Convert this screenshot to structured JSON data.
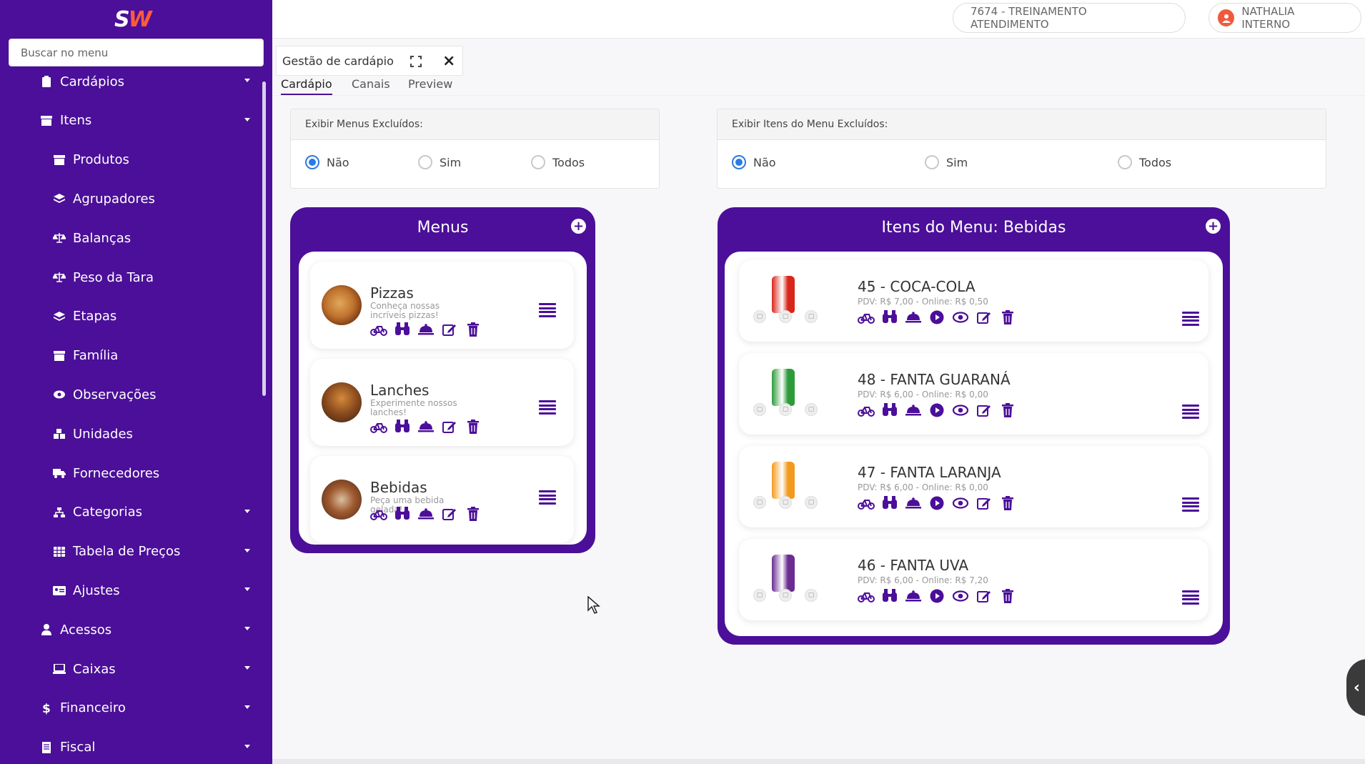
{
  "app": {
    "logo_text": "SW",
    "search_placeholder": "Buscar no menu"
  },
  "colors": {
    "brand": "#4b0f99",
    "accent": "#ff5a3c",
    "radio_selected": "#2a7be4"
  },
  "sidebar": {
    "items": [
      {
        "label": "Cardápios",
        "icon": "clipboard-icon",
        "caret": true
      },
      {
        "label": "Itens",
        "icon": "box-icon",
        "caret": true
      },
      {
        "label": "Produtos",
        "icon": "box-icon",
        "caret": false
      },
      {
        "label": "Agrupadores",
        "icon": "layers-icon",
        "caret": false
      },
      {
        "label": "Balanças",
        "icon": "scale-icon",
        "caret": false
      },
      {
        "label": "Peso da Tara",
        "icon": "scale-icon",
        "caret": false
      },
      {
        "label": "Etapas",
        "icon": "layers-icon",
        "caret": false
      },
      {
        "label": "Família",
        "icon": "box-icon",
        "caret": false
      },
      {
        "label": "Observações",
        "icon": "eye-icon",
        "caret": false
      },
      {
        "label": "Unidades",
        "icon": "cubes-icon",
        "caret": false
      },
      {
        "label": "Fornecedores",
        "icon": "truck-icon",
        "caret": false
      },
      {
        "label": "Categorias",
        "icon": "sitemap-icon",
        "caret": true
      },
      {
        "label": "Tabela de Preços",
        "icon": "table-icon",
        "caret": true
      },
      {
        "label": "Ajustes",
        "icon": "id-card-icon",
        "caret": true
      },
      {
        "label": "Acessos",
        "icon": "user-icon",
        "caret": true
      },
      {
        "label": "Caixas",
        "icon": "laptop-icon",
        "caret": true
      },
      {
        "label": "Financeiro",
        "icon": "dollar-icon",
        "caret": true
      },
      {
        "label": "Fiscal",
        "icon": "receipt-icon",
        "caret": true
      }
    ]
  },
  "topbar": {
    "store": "7674 - TREINAMENTO ATENDIMENTO",
    "user": "NATHALIA INTERNO"
  },
  "window": {
    "title": "Gestão de cardápio",
    "tabs": [
      "Cardápio",
      "Canais",
      "Preview"
    ]
  },
  "filters": {
    "menus": {
      "label": "Exibir Menus Excluídos:",
      "options": [
        "Não",
        "Sim",
        "Todos"
      ],
      "selected": "Não"
    },
    "items": {
      "label": "Exibir Itens do Menu Excluídos:",
      "options": [
        "Não",
        "Sim",
        "Todos"
      ],
      "selected": "Não"
    }
  },
  "menus_card": {
    "title": "Menus",
    "rows": [
      {
        "name": "Pizzas",
        "description": "Conheça nossas incríveis pizzas!"
      },
      {
        "name": "Lanches",
        "description": "Experimente nossos lanches!"
      },
      {
        "name": "Bebidas",
        "description": "Peça uma bebida gelada!"
      }
    ]
  },
  "items_card": {
    "title": "Itens do Menu: Bebidas",
    "rows": [
      {
        "name": "45 - COCA-COLA",
        "price": "PDV: R$ 7,00 - Online: R$ 0,50",
        "color": "#d8261c"
      },
      {
        "name": "48 - FANTA GUARANÁ",
        "price": "PDV: R$ 6,00 - Online: R$ 0,00",
        "color": "#2e9b3a"
      },
      {
        "name": "47 - FANTA LARANJA",
        "price": "PDV: R$ 6,00 - Online: R$ 0,00",
        "color": "#f29a1f"
      },
      {
        "name": "46 - FANTA UVA",
        "price": "PDV: R$ 6,00 - Online: R$ 7,20",
        "color": "#6a2c91"
      }
    ]
  }
}
